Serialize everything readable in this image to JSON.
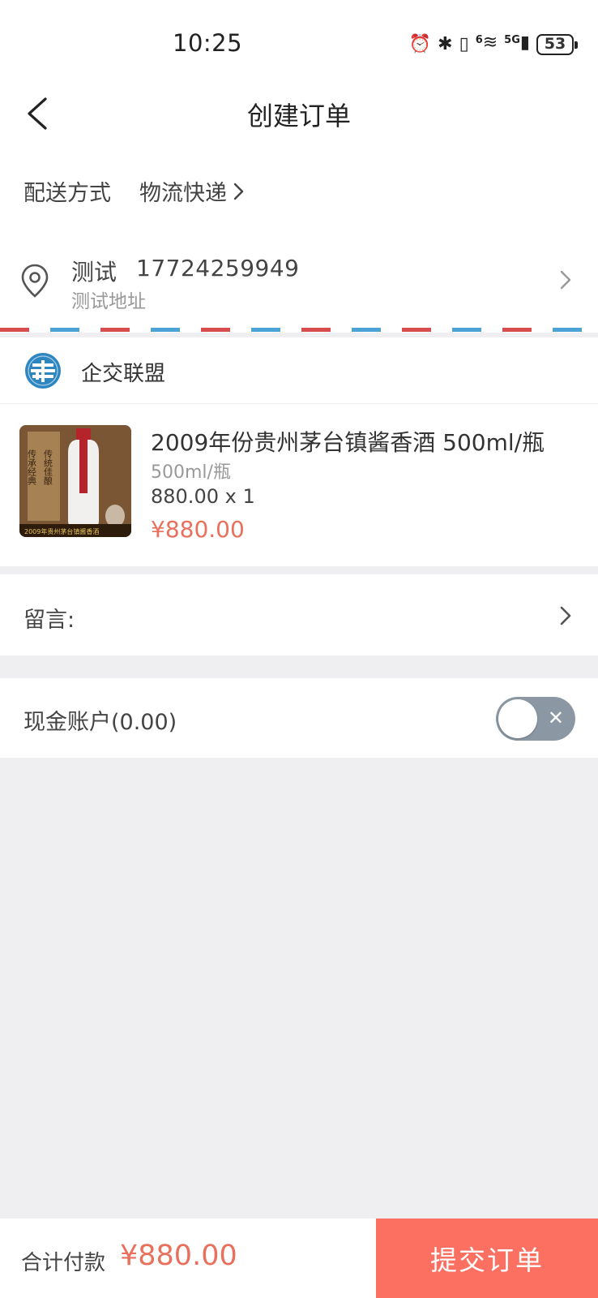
{
  "status_bar": {
    "time": "10:25",
    "network": "5G",
    "wifi_badge": "6",
    "battery": "53"
  },
  "nav": {
    "title": "创建订单"
  },
  "delivery": {
    "label": "配送方式",
    "value": "物流快递"
  },
  "address": {
    "name": "测试",
    "phone": "17724259949",
    "detail": "测试地址"
  },
  "shop": {
    "name": "企交联盟",
    "logo_color": "#2e86c1"
  },
  "product": {
    "title": "2009年份贵州茅台镇酱香酒 500ml/瓶",
    "spec": "500ml/瓶",
    "qty_line": "880.00 x 1",
    "price": "¥880.00",
    "image_text": "传承经典·传统佳酿",
    "image_caption": "2009年贵州茅台镇酱香酒"
  },
  "message": {
    "label": "留言:"
  },
  "cash_account": {
    "label": "现金账户(0.00)",
    "enabled": false
  },
  "footer": {
    "total_label": "合计付款",
    "total_amount": "¥880.00",
    "submit_label": "提交订单"
  },
  "colors": {
    "accent": "#fb7060",
    "price": "#e8705c",
    "toggle_off": "#8b98a4",
    "background": "#efeff1"
  }
}
